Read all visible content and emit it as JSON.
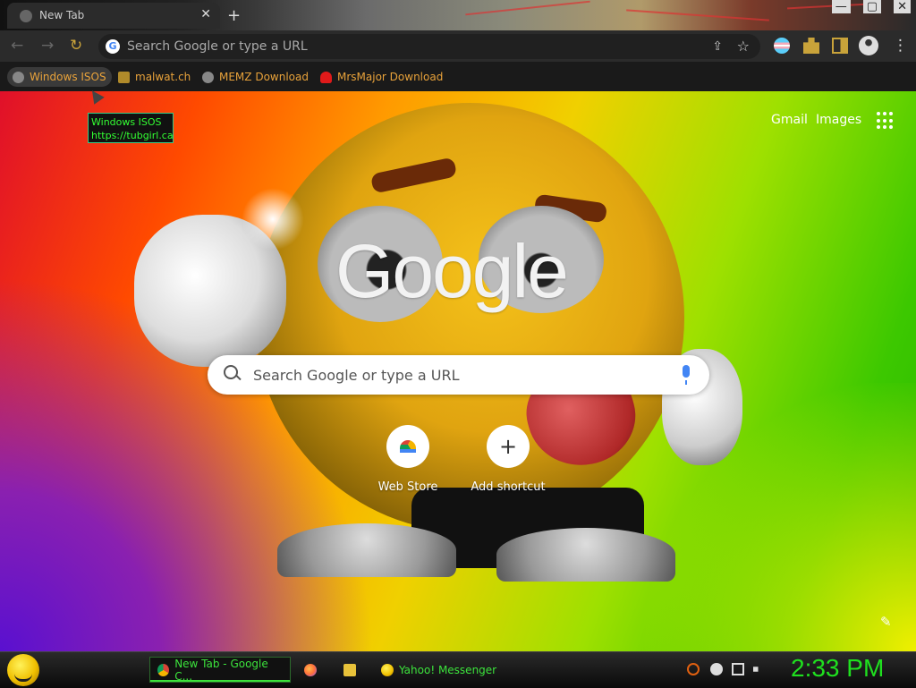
{
  "window": {
    "tab_title": "New Tab",
    "tab_close": "✕",
    "new_tab": "+",
    "controls": [
      "—",
      "▢",
      "✕"
    ]
  },
  "toolbar": {
    "back": "←",
    "forward": "→",
    "reload": "↻",
    "omnibox_placeholder": "Search Google or type a URL",
    "google_g": "G",
    "star": "☆",
    "share": "⇪",
    "menu": "⋮"
  },
  "bookmarks": [
    {
      "label": "Windows ISOS"
    },
    {
      "label": "malwat.ch"
    },
    {
      "label": "MEMZ Download"
    },
    {
      "label": "MrsMajor Download"
    }
  ],
  "tooltip": {
    "title": "Windows ISOS",
    "url": "https://tubgirl.ca"
  },
  "ntp": {
    "gmail": "Gmail",
    "images": "Images",
    "logo": "Google",
    "search_placeholder": "Search Google or type a URL",
    "shortcuts": [
      {
        "label": "Web Store",
        "icon": "web-store-icon"
      },
      {
        "label": "Add shortcut",
        "icon": "plus-icon",
        "glyph": "+"
      }
    ],
    "customize_glyph": "✎"
  },
  "taskbar": {
    "tasks": [
      {
        "label": "New Tab - Google C...",
        "icon": "chrome-icon",
        "active": true
      },
      {
        "label": "",
        "icon": "firefox-icon"
      },
      {
        "label": "",
        "icon": "folder-icon"
      },
      {
        "label": "Yahoo! Messenger",
        "icon": "smiley-icon"
      }
    ],
    "clock": "2:33 PM"
  },
  "colors": {
    "bookmark_text": "#e8a23a",
    "taskbar_text": "#3ce23c",
    "clock": "#1fe01f",
    "accent_gold": "#c9a33a"
  }
}
